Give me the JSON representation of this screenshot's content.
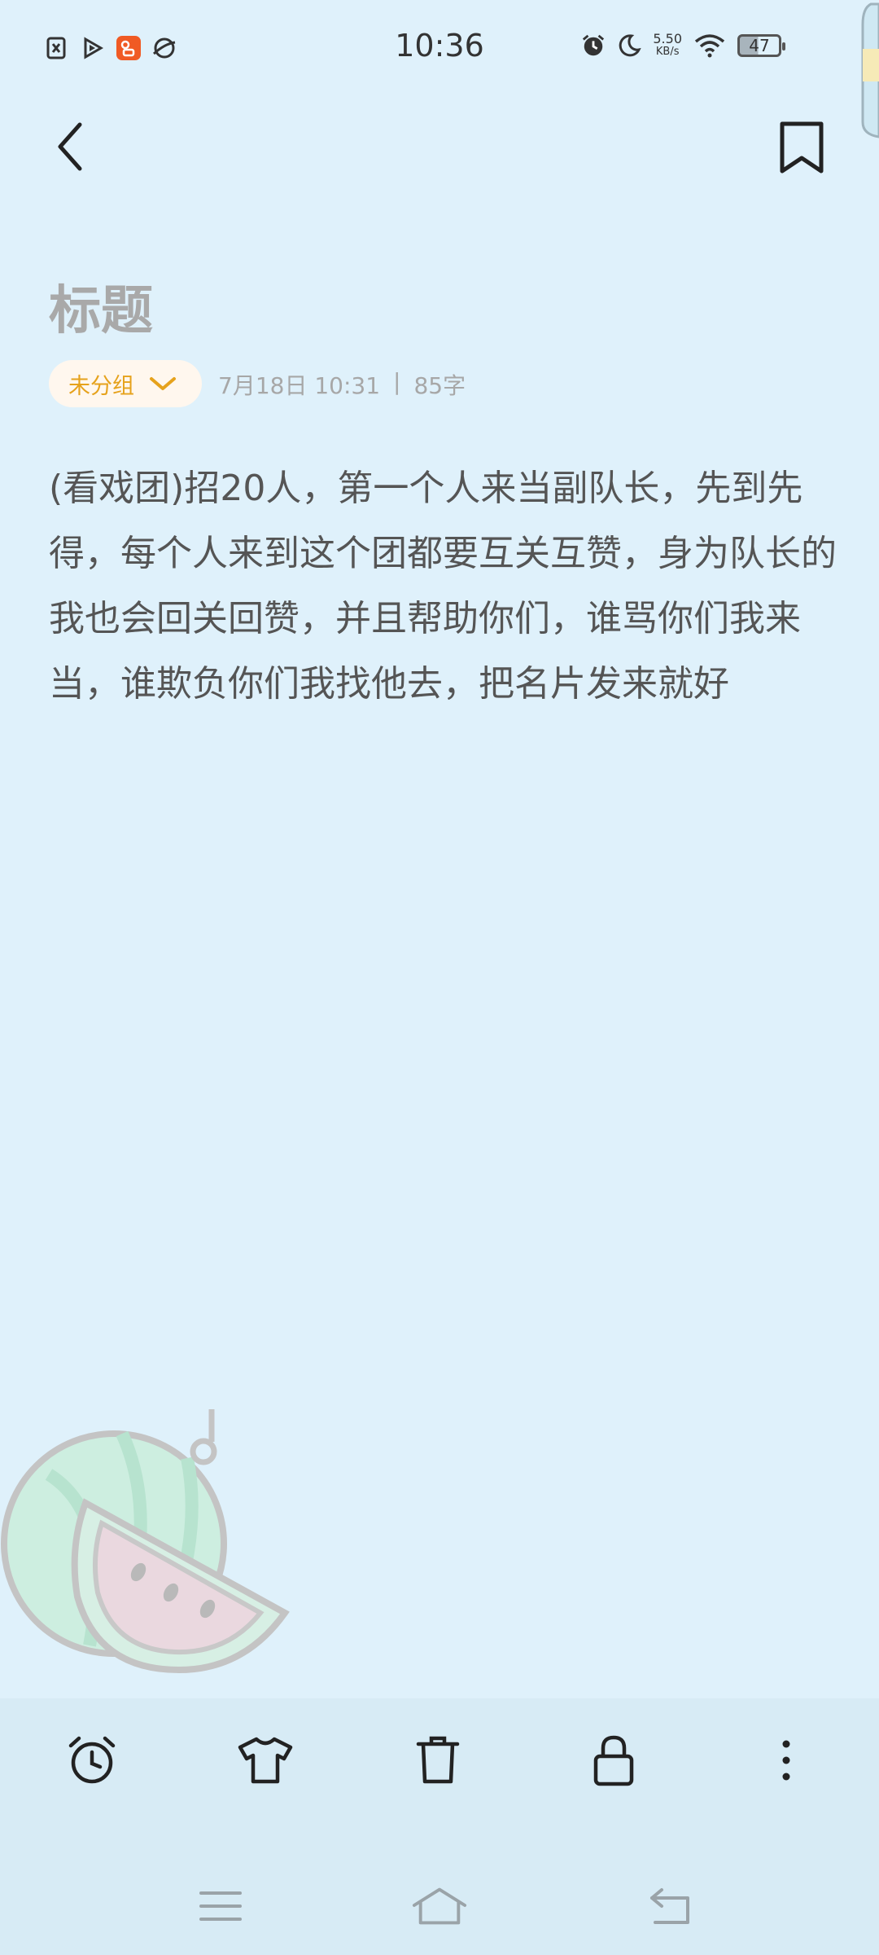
{
  "status_bar": {
    "time": "10:36",
    "net_speed_value": "5.50",
    "net_speed_unit": "KB/s",
    "battery": "47"
  },
  "note": {
    "title": "标题",
    "group": "未分组",
    "date": "7月18日 10:31",
    "separator": "|",
    "word_count": "85字",
    "content": "(看戏团)招20人，第一个人来当副队长，先到先得，每个人来到这个团都要互关互赞，身为队长的我也会回关回赞，并且帮助你们，谁骂你们我来当，谁欺负你们我找他去，把名片发来就好"
  },
  "toolbar": {
    "icons": [
      "alarm-icon",
      "shirt-icon",
      "trash-icon",
      "lock-icon",
      "more-icon"
    ]
  },
  "colors": {
    "background": "#dff1fb",
    "toolbar": "#d7ebf5",
    "accent": "#e6a21c"
  }
}
